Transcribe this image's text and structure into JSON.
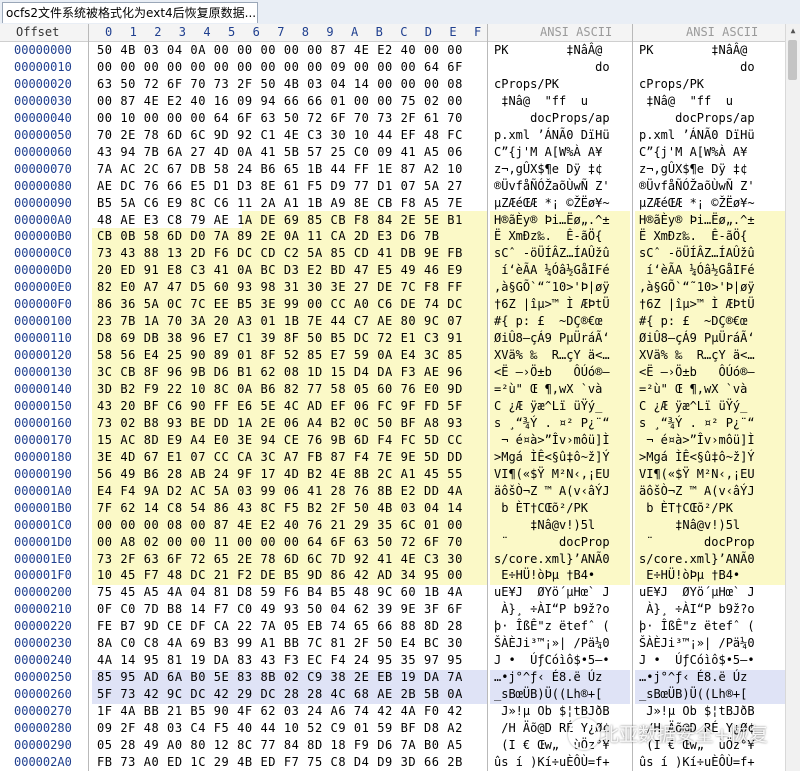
{
  "tab": {
    "title": "ocfs2文件系统被格式化为ext4后恢复原数据..."
  },
  "header": {
    "offset": "Offset",
    "hex_cols": [
      "0",
      "1",
      "2",
      "3",
      "4",
      "5",
      "6",
      "7",
      "8",
      "9",
      "A",
      "B",
      "C",
      "D",
      "E",
      "F"
    ],
    "ansi1": "ANSI ASCII",
    "ansi2": "ANSI ASCII"
  },
  "rows": [
    {
      "off": "00000000",
      "hex": "50 4B 03 04 0A 00 00 00 00 00 87 4E E2 40 00 00",
      "txt": "PK        ‡NâÂ@"
    },
    {
      "off": "00000010",
      "hex": "00 00 00 00 00 00 00 00 00 00 09 00 00 00 64 6F",
      "txt": "              do"
    },
    {
      "off": "00000020",
      "hex": "63 50 72 6F 70 73 2F 50 4B 03 04 14 00 00 00 08",
      "txt": "cProps/PK"
    },
    {
      "off": "00000030",
      "hex": "00 87 4E E2 40 16 09 94 66 66 01 00 00 75 02 00",
      "txt": " ‡Nâ@  \"ff  u"
    },
    {
      "off": "00000040",
      "hex": "00 10 00 00 00 64 6F 63 50 72 6F 70 73 2F 61 70",
      "txt": "     docProps/ap"
    },
    {
      "off": "00000050",
      "hex": "70 2E 78 6D 6C 9D 92 C1 4E C3 30 10 44 EF 48 FC",
      "txt": "p.xml ’ÁNÃ0 DïHü"
    },
    {
      "off": "00000060",
      "hex": "43 94 7B 6A 27 4D 0A 41 5B 57 25 C0 09 41 A5 06",
      "txt": "C”{j'M A[W%À A¥"
    },
    {
      "off": "00000070",
      "hex": "7A AC 2C 67 DB 58 24 B6 65 1B 44 FF 1E 87 A2 10",
      "txt": "z¬,gÛX$¶e Dÿ ‡¢"
    },
    {
      "off": "00000080",
      "hex": "AE DC 76 66 E5 D1 D3 8E 61 F5 D9 77 D1 07 5A 27",
      "txt": "®ÜvfåÑÓŽaõÙwÑ Z'"
    },
    {
      "off": "00000090",
      "hex": "B5 5A C6 E9 8C C6 11 2A A1 1B A9 8E CB F8 A5 7E",
      "txt": "µZÆéŒÆ *¡ ©ŽËø¥~"
    },
    {
      "off": "000000A0",
      "hex": "48 AE E3 C8 79 AE 1A DE 69 85 CB F8 84 2E 5E B1",
      "txt": "H®ãÈy® Þi…Ëø„.^±"
    },
    {
      "off": "000000B0",
      "hex": "CB 0B 58 6D D0 7A 89 2E 0A 11 CA 2D E3 D6 7B",
      "txt": "Ë XmÐz‰.  Ê-ãÖ{"
    },
    {
      "off": "000000C0",
      "hex": "73 43 88 13 2D F6 DC CD C2 5A 85 CD 41 DB 9E FB",
      "txt": "sCˆ -öÜÍÂZ…ÍAÛžû"
    },
    {
      "off": "000000D0",
      "hex": "20 ED 91 E8 C3 41 0A BC D3 E2 BD 47 E5 49 46 E9",
      "txt": " í‘èÃA ¼Óâ½GåIFé"
    },
    {
      "off": "000000E0",
      "hex": "82 E0 A7 47 D5 60 93 98 31 30 3E 27 DE 7C F8 FF",
      "txt": "‚à§GÕ`“˜10>'Þ|øÿ"
    },
    {
      "off": "000000F0",
      "hex": "86 36 5A 0C 7C EE B5 3E 99 00 CC A0 C6 DE 74 DC",
      "txt": "†6Z |îµ>™ Ì ÆÞtÜ"
    },
    {
      "off": "00000100",
      "hex": "23 7B 1A 70 3A 20 A3 01 1B 7E 44 C7 AE 80 9C 07",
      "txt": "#{ p: £  ~DÇ®€œ"
    },
    {
      "off": "00000110",
      "hex": "D8 69 DB 38 96 E7 C1 39 8F 50 B5 DC 72 E1 C3 91",
      "txt": "ØiÛ8–çÁ9 PµÜráÃ‘"
    },
    {
      "off": "00000120",
      "hex": "58 56 E4 25 90 89 01 8F 52 85 E7 59 0A E4 3C 85",
      "txt": "XVä% ‰  R…çY ä<…"
    },
    {
      "off": "00000130",
      "hex": "3C CB 8F 96 9B D6 B1 62 08 1D 15 D4 DA F3 AE 96",
      "txt": "<Ë –›Ö±b   ÔÚó®–"
    },
    {
      "off": "00000140",
      "hex": "3D B2 F9 22 10 8C 0A B6 82 77 58 05 60 76 E0 9D",
      "txt": "=²ù\" Œ ¶‚wX `và"
    },
    {
      "off": "00000150",
      "hex": "43 20 BF C6 90 FF E6 5E 4C AD EF 06 FC 9F FD 5F",
      "txt": "C ¿Æ ÿæ^L­ï üŸý_"
    },
    {
      "off": "00000160",
      "hex": "73 02 B8 93 BE DD 1A 2E 06 A4 B2 0C 50 BF A8 93",
      "txt": "s ¸“¾Ý . ¤² P¿¨“"
    },
    {
      "off": "00000170",
      "hex": "15 AC 8D E9 A4 E0 3E 94 CE 76 9B 6D F4 FC 5D CC",
      "txt": " ¬ é¤à>”Îv›môü]Ì"
    },
    {
      "off": "00000180",
      "hex": "3E 4D 67 E1 07 CC CA 3C A7 FB 87 F4 7E 9E 5D DD",
      "txt": ">Mgá ÌÊ<§û‡ô~ž]Ý"
    },
    {
      "off": "00000190",
      "hex": "56 49 B6 28 AB 24 9F 17 4D B2 4E 8B 2C A1 45 55",
      "txt": "VI¶(«$Ÿ M²N‹,¡EU"
    },
    {
      "off": "000001A0",
      "hex": "E4 F4 9A D2 AC 5A 03 99 06 41 28 76 8B E2 DD 4A",
      "txt": "äôšÒ¬Z ™ A(v‹âÝJ"
    },
    {
      "off": "000001B0",
      "hex": "7F 62 14 C8 54 86 43 8C F5 B2 2F 50 4B 03 04 14",
      "txt": " b ÈT†CŒõ²/PK"
    },
    {
      "off": "000001C0",
      "hex": "00 00 00 08 00 87 4E E2 40 76 21 29 35 6C 01 00",
      "txt": "     ‡Nâ@v!)5l"
    },
    {
      "off": "000001D0",
      "hex": "00 A8 02 00 00 11 00 00 00 64 6F 63 50 72 6F 70",
      "txt": " ¨       docProp"
    },
    {
      "off": "000001E0",
      "hex": "73 2F 63 6F 72 65 2E 78 6D 6C 7D 92 41 4E C3 30",
      "txt": "s/core.xml}’ANÃ0"
    },
    {
      "off": "000001F0",
      "hex": "10 45 F7 48 DC 21 F2 DE B5 9D 86 42 AD 34 95 00",
      "txt": " E÷HÜ!òÞµ †B­4•"
    },
    {
      "off": "00000200",
      "hex": "75 45 A5 4A 04 81 D8 59 F6 B4 B5 48 9C 60 1B 4A",
      "txt": "uE¥J  ØYö´µHœ` J"
    },
    {
      "off": "00000210",
      "hex": "0F C0 7D B8 14 F7 C0 49 93 50 04 62 39 9E 3F 6F",
      "txt": " À}¸ ÷ÀI“P b9ž?o"
    },
    {
      "off": "00000220",
      "hex": "FE B7 9D CE DF CA 22 7A 05 EB 74 65 66 88 8D 28",
      "txt": "þ· ÎßÊ\"z ëtefˆ ("
    },
    {
      "off": "00000230",
      "hex": "8A C0 C8 4A 69 B3 99 A1 BB 7C 81 2F 50 E4 BC 30",
      "txt": "ŠÀÈJi³™¡»| /Pä¼0"
    },
    {
      "off": "00000240",
      "hex": "4A 14 95 81 19 DA 83 43 F3 EC F4 24 95 35 97 95",
      "txt": "J •  ÚƒCóìô$•5—•"
    },
    {
      "off": "00000250",
      "hex": "85 95 AD 6A B0 5E 83 8B 02 C9 38 2E EB 19 DA 7A",
      "txt": "…•­j°^ƒ‹ É8.ë Úz"
    },
    {
      "off": "00000260",
      "hex": "5F 73 42 9C DC 42 29 DC 28 28 4C 68 AE 2B 5B 0A",
      "txt": "_sBœÜB)Ü((Lh®+["
    },
    {
      "off": "00000270",
      "hex": "1F 4A BB 21 B5 90 4F 62 03 24 A6 74 42 4A F0 42",
      "txt": " J»!µ Ob $¦tBJðB"
    },
    {
      "off": "00000280",
      "hex": "09 2F 48 03 C4 F5 40 44 10 52 C9 01 59 BF D8 A2",
      "txt": " /H Äõ@D RÉ Y¿Ø¢"
    },
    {
      "off": "00000290",
      "hex": "05 28 49 A0 80 12 8C 77 84 8D 18 F9 D6 7A B0 A5",
      "txt": " (I € Œw„  ùÖz°¥"
    },
    {
      "off": "000002A0",
      "hex": "FB 73 A0 ED 1C 29 4B ED F7 75 C8 D4 D9 3D 66 2B",
      "txt": "ûs í )Kí÷uÈÔÙ=f+"
    }
  ],
  "watermark": {
    "text": "北亚数据安全+恢复"
  }
}
